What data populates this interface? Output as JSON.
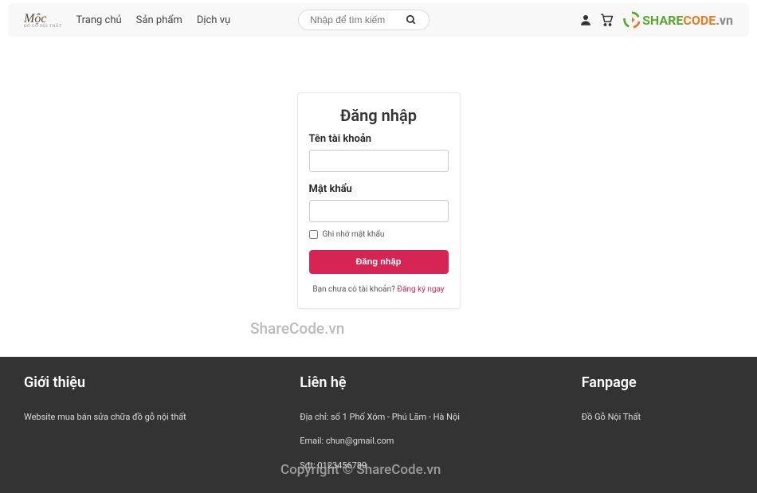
{
  "header": {
    "logo": "Mộc",
    "logo_sub": "ĐỒ GỖ NỘI THẤT",
    "nav": {
      "home": "Trang chủ",
      "products": "Sản phẩm",
      "services": "Dịch vụ"
    },
    "search_placeholder": "Nhập để tìm kiếm",
    "sharecode": {
      "text1": "SHARE",
      "text2": "CODE",
      "suffix": ".vn"
    }
  },
  "login": {
    "title": "Đăng nhập",
    "username_label": "Tên tài khoản",
    "password_label": "Mật khẩu",
    "remember_label": "Ghi nhớ mật khẩu",
    "submit_label": "Đăng nhập",
    "signup_prompt": "Bạn chưa có tài khoản? ",
    "signup_link": "Đăng ký ngay"
  },
  "watermark": {
    "text1": "ShareCode.vn",
    "text2": "Copyright © ShareCode.vn"
  },
  "footer": {
    "col1": {
      "title": "Giới thiệu",
      "text": "Website mua bán sửa chữa đồ gỗ nội thất"
    },
    "col2": {
      "title": "Liên hệ",
      "address": "Địa chỉ: số 1 Phố Xóm - Phú Lãm - Hà Nội",
      "email": "Email: chun@gmail.com",
      "phone": "Sđt: 0123456789"
    },
    "col3": {
      "title": "Fanpage",
      "text": "Đồ Gỗ Nội Thất"
    }
  }
}
